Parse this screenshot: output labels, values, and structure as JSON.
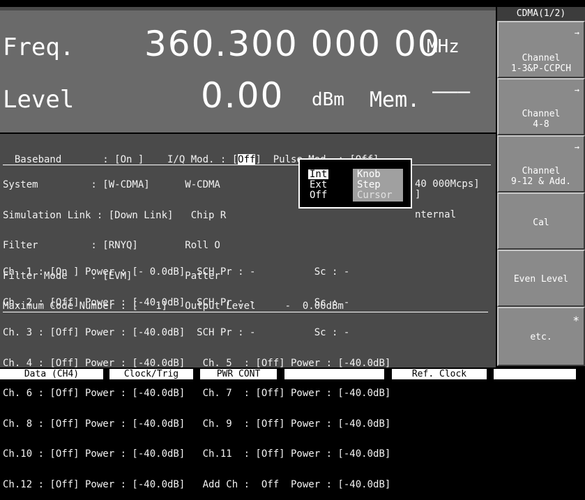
{
  "mode_title": "CDMA(1/2)",
  "freq": {
    "label": "Freq.",
    "value": "360.300 000 00",
    "unit": "MHz"
  },
  "level": {
    "label": "Level",
    "value": "0.00",
    "unit": "dBm",
    "mem_label": "Mem.",
    "mem_value": "———"
  },
  "status": {
    "baseband": "Baseband       : [On ]    I/Q Mod. : [",
    "iq_mod_value": "Off",
    "pulse_mod": "]  Pulse Mod. : [Off]"
  },
  "settings": {
    "lines": [
      "System         : [W-CDMA]      W-CDMA",
      "Simulation Link : [Down Link]   Chip R",
      "Filter         : [RNYQ]        Roll O",
      "Filter Mode    : [EVM]         Patter",
      "Maximum Code Number : [   1]   Output Level     -  0.00dBm"
    ],
    "right_fragments": [
      "40 000Mcps]",
      "]",
      "nternal"
    ]
  },
  "popup": {
    "col1": [
      "Int",
      "Ext",
      "Off"
    ],
    "col2": [
      "Knob",
      "Step",
      "Cursor"
    ],
    "selected_col1": "Int",
    "selected_col2": "Cursor"
  },
  "channels": [
    "Ch. 1 : [On ] Power : [- 0.0dB]  SCH Pr : -          Sc : -",
    "Ch. 2 : [Off] Power : [-40.0dB]  SCH Pr : -          Sc : -",
    "Ch. 3 : [Off] Power : [-40.0dB]  SCH Pr : -          Sc : -",
    "Ch. 4 : [Off] Power : [-40.0dB]   Ch. 5  : [Off] Power : [-40.0dB]",
    "Ch. 6 : [Off] Power : [-40.0dB]   Ch. 7  : [Off] Power : [-40.0dB]",
    "Ch. 8 : [Off] Power : [-40.0dB]   Ch. 9  : [Off] Power : [-40.0dB]",
    "Ch.10 : [Off] Power : [-40.0dB]   Ch.11  : [Off] Power : [-40.0dB]",
    "Ch.12 : [Off] Power : [-40.0dB]   Add Ch :  Off  Power : [-40.0dB]"
  ],
  "softkeys": [
    {
      "line1": "Channel",
      "line2": "1-3&P-CCPCH",
      "arrow": "→"
    },
    {
      "line1": "Channel",
      "line2": "4-8",
      "arrow": "→"
    },
    {
      "line1": "Channel",
      "line2": "9-12 & Add.",
      "arrow": "→"
    },
    {
      "line1": "Cal",
      "line2": "",
      "arrow": ""
    },
    {
      "line1": "Even Level",
      "line2": "",
      "arrow": ""
    },
    {
      "line1": "etc.",
      "line2": "",
      "arrow": "*"
    }
  ],
  "bottom_tabs": [
    "Data (CH4)",
    "Clock/Trig",
    "PWR CONT",
    "",
    "Ref. Clock"
  ]
}
